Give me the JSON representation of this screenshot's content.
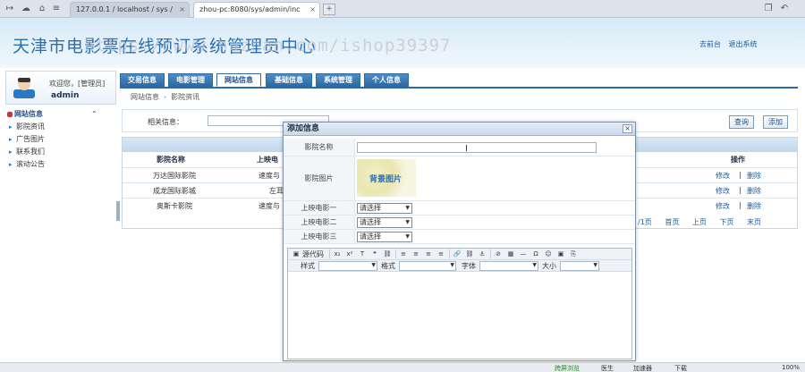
{
  "browser": {
    "tabs": [
      "127.0.0.1 / localhost / sys /",
      "zhou-pc:8080/sys/admin/inc"
    ],
    "status": [
      "跨屏浏览",
      "医生",
      "加速器",
      "下载",
      "100%"
    ]
  },
  "header": {
    "title": "天津市电影票在线预订系统管理员中心",
    "watermark": "https://www.huzhan.com/ishop39397",
    "links": [
      "去前台",
      "退出系统"
    ]
  },
  "user": {
    "welcome": "欢迎您，[管理员]",
    "name": "admin"
  },
  "sidebar": {
    "section": "网站信息",
    "items": [
      "影院资讯",
      "广告图片",
      "联系我们",
      "滚动公告"
    ]
  },
  "nav": {
    "tabs": [
      "交易信息",
      "电影管理",
      "网站信息",
      "基础信息",
      "系统管理",
      "个人信息"
    ],
    "active": "网站信息",
    "breadcrumb": [
      "网站信息",
      "-",
      "影院资讯"
    ]
  },
  "search": {
    "label": "相关信息：",
    "query_label": "查询",
    "add_label": "添加"
  },
  "table": {
    "columns": [
      "影院名称",
      "上映电",
      "操作"
    ],
    "rows": [
      {
        "name": "万达国际影院",
        "movie": "速度与",
        "edit": "修改",
        "sep": "|",
        "del": "删除"
      },
      {
        "name": "成龙国际影城",
        "movie": "左耳",
        "edit": "修改",
        "sep": "|",
        "del": "删除"
      },
      {
        "name": "奥斯卡影院",
        "movie": "速度与",
        "edit": "修改",
        "sep": "|",
        "del": "删除"
      }
    ],
    "pager": [
      "/1页",
      "首页",
      "上页",
      "下页",
      "末页"
    ]
  },
  "modal": {
    "title": "添加信息",
    "close": "×",
    "fields": {
      "cinema_name_label": "影院名称",
      "cinema_image_label": "影院图片",
      "image_button": "背景图片",
      "movie1_label": "上映电影一",
      "movie2_label": "上映电影二",
      "movie3_label": "上映电影三",
      "select_placeholder": "请选择"
    },
    "editor": {
      "source_label": "源代码",
      "style_label": "样式",
      "format_label": "格式",
      "font_label": "字体",
      "size_label": "大小"
    }
  }
}
